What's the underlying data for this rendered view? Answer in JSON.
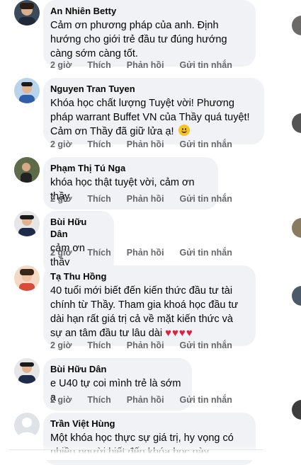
{
  "comments": [
    {
      "name": "An Nhiên Betty",
      "text": "Cảm ơn phương pháp của anh. Định hướng cho giới trẻ đầu tư đúng hướng càng sớm càng tốt.",
      "time": "2 giờ",
      "like": "Thích",
      "reply": "Phản hồi",
      "message": "Gửi tin nhắn"
    },
    {
      "name": "Nguyen Tran Tuyen",
      "text": "Khóa học chất lượng Tuyệt vời! Phương pháp warrant Buffet VN của Thầy quá tuyệt! Cảm ơn Thầy đã giữ lửa ạ!",
      "emoji": "smiling-face-icon",
      "time": "2 giờ",
      "like": "Thích",
      "reply": "Phản hồi",
      "message": "Gửi tin nhắn"
    },
    {
      "name": "Phạm Thị Tú Nga",
      "text": "khóa học thật tuyệt vời, cảm ơn thầy",
      "time": "2 giờ",
      "like": "Thích",
      "reply": "Phản hồi",
      "message": "Gửi tin nhắn"
    },
    {
      "name": "Bùi Hữu Dân",
      "text": "cảm ơn thầy",
      "time": "2 giờ",
      "like": "Thích",
      "reply": "Phản hồi",
      "message": "Gửi tin nhắn"
    },
    {
      "name": "Tạ Thu Hồng",
      "text": "40 tuổi mới biết đến kiến thức đầu tư tài chính từ Thầy. Tham gia khoá học đầu tư dài hạn rất giá trị cả về mặt kiến thức và sự an tâm đầu tư lâu dài",
      "hearts": "♥♥♥♥",
      "time": "2 giờ",
      "like": "Thích",
      "reply": "Phản hồi",
      "message": "Gửi tin nhắn"
    },
    {
      "name": "Bùi Hữu Dân",
      "text": "e U40 tự coi mình trẻ là sớm ạ",
      "time": "2 giờ",
      "like": "Thích",
      "reply": "Phản hồi",
      "message": "Gửi tin nhắn"
    },
    {
      "name": "Trần Việt Hùng",
      "text": "Một khóa học thực sự giá trị, hy vọng có nhiều người biết đến khóa học này."
    }
  ]
}
